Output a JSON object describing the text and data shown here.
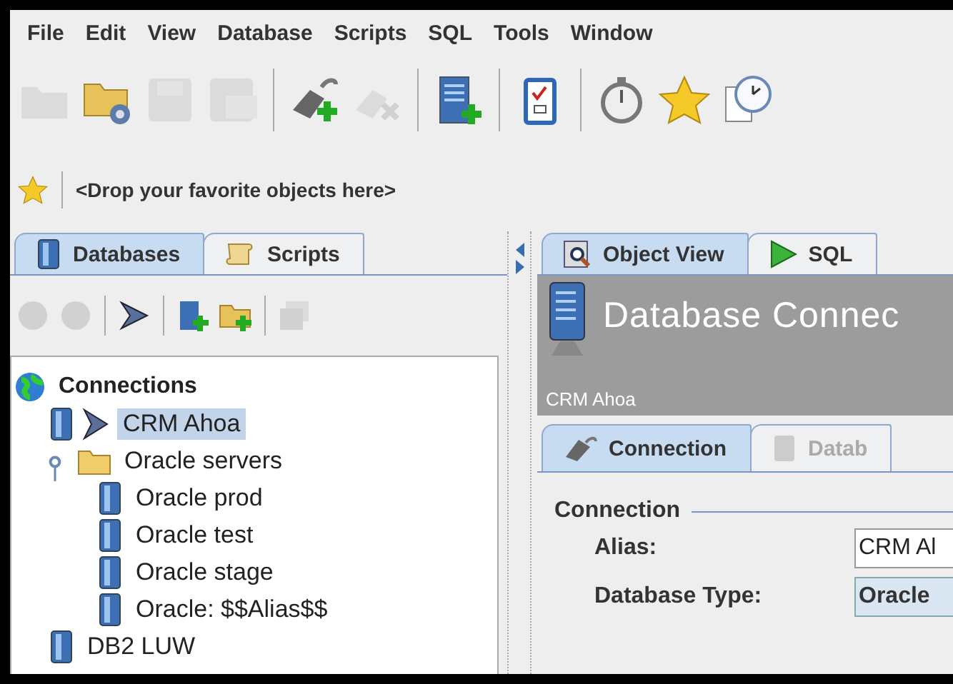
{
  "menu": [
    "File",
    "Edit",
    "View",
    "Database",
    "Scripts",
    "SQL",
    "Tools",
    "Window"
  ],
  "toolbar": {
    "groups": [
      [
        {
          "disabled": true
        },
        {
          "disabled": false
        },
        {
          "disabled": true
        },
        {
          "disabled": true
        }
      ],
      [
        {
          "disabled": false
        },
        {
          "disabled": true
        }
      ],
      [
        {
          "disabled": false
        }
      ],
      [
        {
          "disabled": false
        }
      ],
      [
        {
          "disabled": false
        },
        {
          "disabled": false
        },
        {
          "disabled": false
        }
      ]
    ]
  },
  "favorites": {
    "text": "<Drop your favorite objects here>"
  },
  "left_panel": {
    "tabs": [
      {
        "label": "Databases",
        "selected": true
      },
      {
        "label": "Scripts",
        "selected": false
      }
    ],
    "toolbar": {
      "groups": [
        [
          {
            "disabled": true
          },
          {
            "disabled": true
          }
        ],
        [
          {
            "disabled": false
          }
        ],
        [
          {
            "disabled": false
          },
          {
            "disabled": false
          }
        ],
        [
          {
            "disabled": true
          }
        ]
      ]
    },
    "tree": {
      "label": "Connections",
      "kind": "root",
      "children": [
        {
          "label": "CRM Ahoa",
          "kind": "connection",
          "filtered": true,
          "selected": true
        },
        {
          "label": "Oracle servers",
          "kind": "folder",
          "filtered": false,
          "selected": false,
          "expanded": true,
          "children": [
            {
              "label": "Oracle prod",
              "kind": "connection",
              "filtered": false,
              "selected": false
            },
            {
              "label": "Oracle test",
              "kind": "connection",
              "filtered": false,
              "selected": false
            },
            {
              "label": "Oracle stage",
              "kind": "connection",
              "filtered": false,
              "selected": false
            },
            {
              "label": "Oracle: $$Alias$$",
              "kind": "connection",
              "filtered": false,
              "selected": false
            }
          ]
        },
        {
          "label": "DB2 LUW",
          "kind": "connection",
          "filtered": false,
          "selected": false
        }
      ]
    }
  },
  "right_panel": {
    "tabs": [
      {
        "label": "Object View",
        "selected": true
      },
      {
        "label": "SQL",
        "selected": false
      }
    ],
    "header": {
      "title": "Database Connec",
      "subtitle": "CRM Ahoa"
    },
    "subtabs": [
      {
        "label": "Connection",
        "selected": true,
        "disabled": false
      },
      {
        "label": "Datab",
        "selected": false,
        "disabled": true
      }
    ],
    "form": {
      "section": "Connection",
      "fields": [
        {
          "label": "Alias:",
          "value": "CRM Al",
          "kind": "text"
        },
        {
          "label": "Database Type:",
          "value": "Oracle",
          "kind": "combo"
        }
      ]
    }
  }
}
